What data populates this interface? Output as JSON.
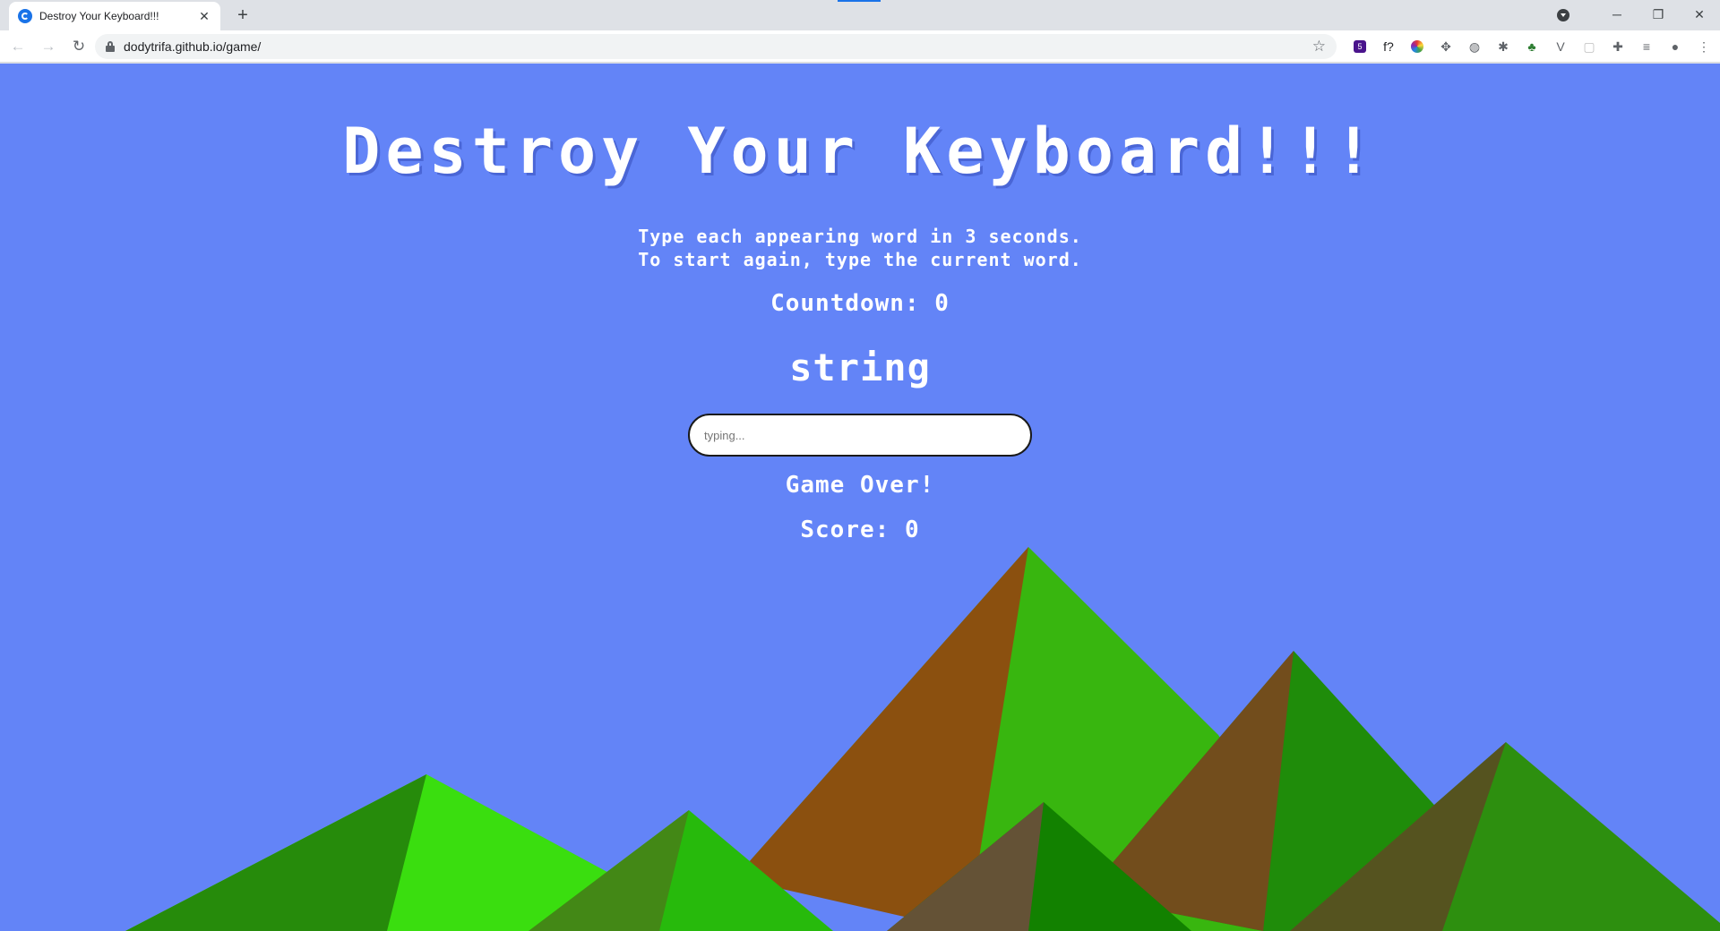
{
  "browser": {
    "tab_title": "Destroy Your Keyboard!!!",
    "tab_close": "✕",
    "new_tab": "+",
    "url": "dodytrifa.github.io/game/",
    "window_controls": {
      "minimize": "─",
      "restore": "❐",
      "close": "✕"
    },
    "extensions": [
      {
        "name": "extension-badge-icon",
        "text": "5",
        "color": "#4a148c"
      },
      {
        "name": "function-ext-icon",
        "text": "f?",
        "color": "#202124"
      },
      {
        "name": "color-wheel-icon",
        "text": "",
        "color": "#e53935"
      },
      {
        "name": "move-icon",
        "text": "✥",
        "color": "#5f6368"
      },
      {
        "name": "globe-ext-icon",
        "text": "◍",
        "color": "#5f6368"
      },
      {
        "name": "bug-ext-icon",
        "text": "✱",
        "color": "#5f6368"
      },
      {
        "name": "tree-ext-icon",
        "text": "♣",
        "color": "#2e7d32"
      },
      {
        "name": "vue-ext-icon",
        "text": "V",
        "color": "#5f6368"
      },
      {
        "name": "blank-ext-icon",
        "text": "▢",
        "color": "#c0c0c0"
      },
      {
        "name": "puzzle-icon",
        "text": "✚",
        "color": "#5f6368"
      },
      {
        "name": "media-queue-icon",
        "text": "≡",
        "color": "#5f6368"
      },
      {
        "name": "profile-icon",
        "text": "●",
        "color": "#5f6368"
      },
      {
        "name": "menu-dots-icon",
        "text": "⋮",
        "color": "#5f6368"
      }
    ]
  },
  "game": {
    "title": "Destroy Your Keyboard!!!",
    "instructions_line1": "Type each appearing word in 3 seconds.",
    "instructions_line2": "To start again, type the current word.",
    "countdown_label": "Countdown: 0",
    "current_word": "string",
    "input_placeholder": "typing...",
    "input_value": "",
    "status": "Game Over!",
    "score_label": "Score: 0"
  },
  "colors": {
    "background": "#6384f7",
    "text": "#ffffff"
  }
}
